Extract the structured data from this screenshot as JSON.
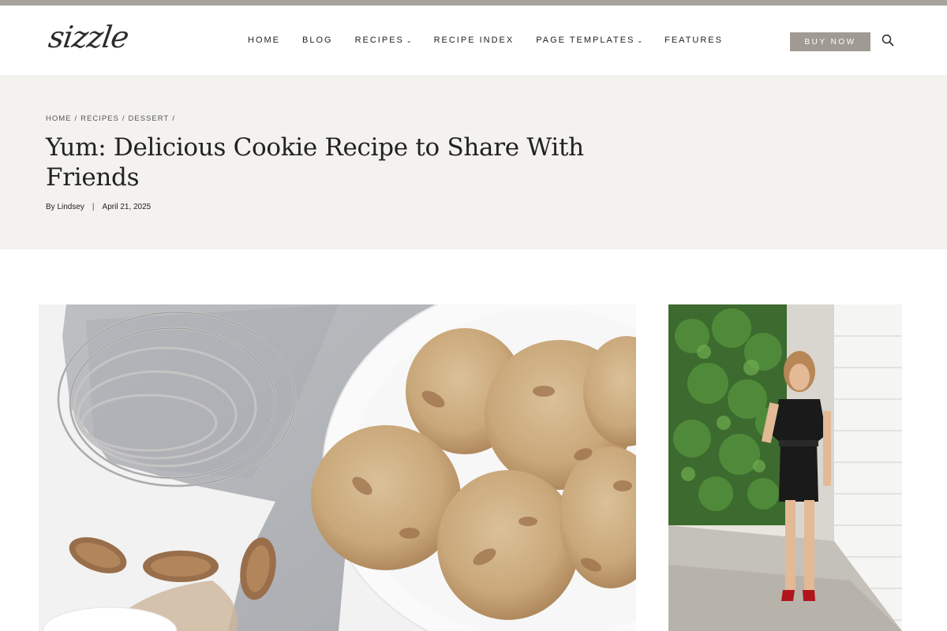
{
  "site": {
    "logo": "sizzle"
  },
  "nav": {
    "items": [
      {
        "label": "HOME",
        "dropdown": false
      },
      {
        "label": "BLOG",
        "dropdown": false
      },
      {
        "label": "RECIPES",
        "dropdown": true
      },
      {
        "label": "RECIPE INDEX",
        "dropdown": false
      },
      {
        "label": "PAGE TEMPLATES",
        "dropdown": true
      },
      {
        "label": "FEATURES",
        "dropdown": false
      }
    ],
    "buy_label": "BUY NOW",
    "search_icon": "search-icon"
  },
  "breadcrumb": {
    "items": [
      "HOME",
      "RECIPES",
      "DESSERT"
    ],
    "separator": "/"
  },
  "post": {
    "title": "Yum: Delicious Cookie Recipe to Share With Friends",
    "byline": "By Lindsey",
    "divider": "|",
    "date": "April 21, 2025"
  },
  "colors": {
    "top_strip": "#a8a39c",
    "hero_bg": "#f3f2ef",
    "button_bg": "#a09a93"
  }
}
